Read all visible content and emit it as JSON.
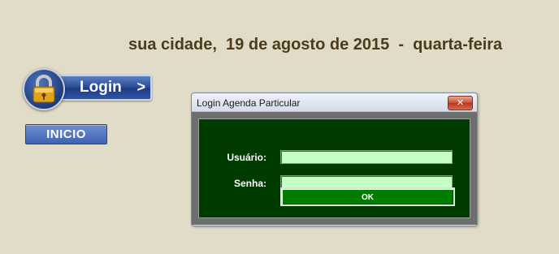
{
  "header": {
    "date_line": "sua cidade,  19 de agosto de 2015  -  quarta-feira"
  },
  "sidebar": {
    "login_label": "Login",
    "login_chevron": ">",
    "login_icon": "padlock-icon",
    "inicio_label": "INICIO"
  },
  "dialog": {
    "title": "Login Agenda Particular",
    "close_glyph": "✕",
    "user_label": "Usuário:",
    "user_value": "",
    "password_label": "Senha:",
    "password_value": "",
    "ok_label": "OK"
  },
  "colors": {
    "background": "#e1dcc8",
    "header_text": "#4a3c1c",
    "form_panel": "#003c00",
    "input_fill": "#c4ffc4",
    "ok_button": "#007d00",
    "brand_blue": "#2c4f9a"
  }
}
